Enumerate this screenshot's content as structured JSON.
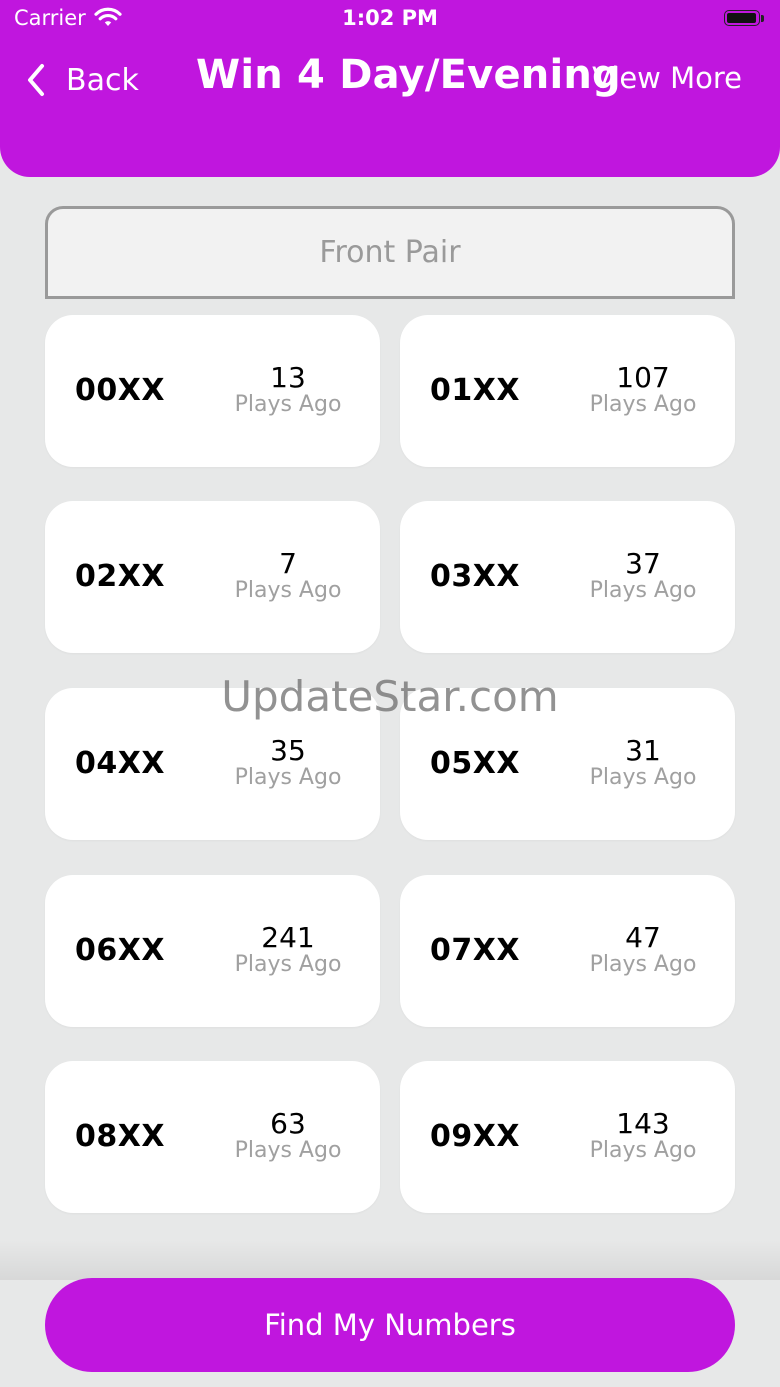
{
  "status": {
    "carrier": "Carrier",
    "time": "1:02 PM"
  },
  "nav": {
    "back_label": "Back",
    "title": "Win 4 Day/Evening",
    "view_more": "View More"
  },
  "segment": {
    "label": "Front Pair"
  },
  "cards": [
    {
      "pair": "00XX",
      "count": "13",
      "label": "Plays Ago"
    },
    {
      "pair": "01XX",
      "count": "107",
      "label": "Plays Ago"
    },
    {
      "pair": "02XX",
      "count": "7",
      "label": "Plays Ago"
    },
    {
      "pair": "03XX",
      "count": "37",
      "label": "Plays Ago"
    },
    {
      "pair": "04XX",
      "count": "35",
      "label": "Plays Ago"
    },
    {
      "pair": "05XX",
      "count": "31",
      "label": "Plays Ago"
    },
    {
      "pair": "06XX",
      "count": "241",
      "label": "Plays Ago"
    },
    {
      "pair": "07XX",
      "count": "47",
      "label": "Plays Ago"
    },
    {
      "pair": "08XX",
      "count": "63",
      "label": "Plays Ago"
    },
    {
      "pair": "09XX",
      "count": "143",
      "label": "Plays Ago"
    }
  ],
  "watermark": "UpdateStar.com",
  "find_button": "Find My Numbers",
  "colors": {
    "accent": "#c016de",
    "background": "#e7e8e8",
    "muted_text": "#a0a0a0"
  }
}
